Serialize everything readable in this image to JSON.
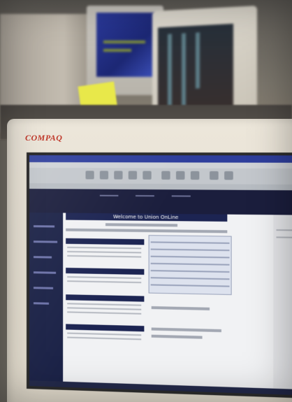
{
  "monitor": {
    "brand": "COMPAQ"
  },
  "screen_page": {
    "welcome_text": "Welcome to Union OnLine"
  },
  "colors": {
    "brand_red": "#c0392b",
    "page_navy": "#1c2452",
    "sticky_note": "#e8e84a"
  }
}
